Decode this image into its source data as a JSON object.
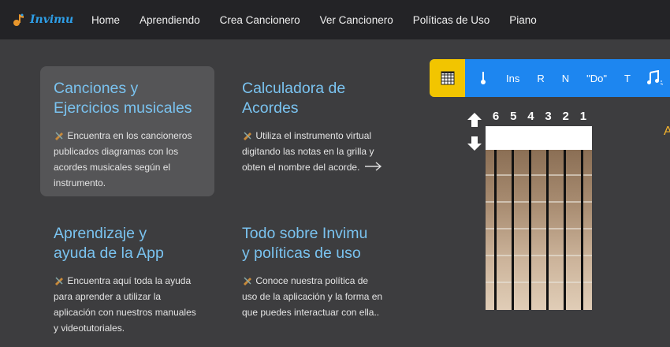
{
  "app": {
    "name": "Invimu"
  },
  "nav": {
    "items": [
      {
        "label": "Home"
      },
      {
        "label": "Aprendiendo"
      },
      {
        "label": "Crea Cancionero"
      },
      {
        "label": "Ver Cancionero"
      },
      {
        "label": "Políticas de Uso"
      },
      {
        "label": "Piano"
      }
    ]
  },
  "cards": [
    {
      "title_l1": "Canciones y",
      "title_l2": "Ejercicios musicales",
      "desc": "Encuentra en los cancioneros publicados diagramas con los acordes musicales según el instrumento."
    },
    {
      "title_l1": "Calculadora de",
      "title_l2": "Acordes",
      "desc": "Utiliza el instrumento virtual digitando las notas en la grilla y obten el nombre del acorde."
    },
    {
      "title_l1": "Aprendizaje y",
      "title_l2": "ayuda de la App",
      "desc": "Encuentra aquí toda la ayuda para aprender a utilizar la aplicación con nuestros manuales y videotutoriales."
    },
    {
      "title_l1": "Todo sobre Invimu",
      "title_l2": "y políticas de uso",
      "desc": "Conoce nuestra política de uso de la aplicación y la forma en que puedes interactuar con ella.."
    }
  ],
  "toolbar": {
    "buttons": [
      {
        "label": "Ins"
      },
      {
        "label": "R"
      },
      {
        "label": "N"
      },
      {
        "label": "\"Do\""
      },
      {
        "label": "T"
      }
    ]
  },
  "fretboard": {
    "string_numbers": [
      "6",
      "5",
      "4",
      "3",
      "2",
      "1"
    ],
    "side_letter": "A"
  },
  "colors": {
    "accent_blue": "#1d86f0",
    "accent_yellow": "#f2c500",
    "title_blue": "#7ac3f0"
  }
}
